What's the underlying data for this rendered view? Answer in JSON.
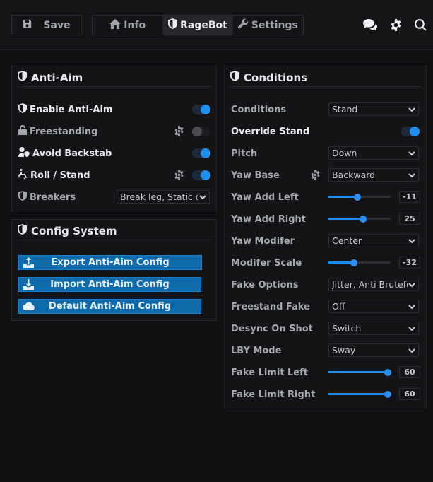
{
  "toolbar": {
    "save_label": "Save",
    "tabs": [
      {
        "label": "Info",
        "icon": "home-icon",
        "active": false
      },
      {
        "label": "RageBot",
        "icon": "shield-icon",
        "active": true
      },
      {
        "label": "Settings",
        "icon": "wrench-icon",
        "active": false
      }
    ],
    "right_icons": [
      "chat-icon",
      "gear-icon",
      "search-icon"
    ]
  },
  "anti_aim": {
    "title": "Anti-Aim",
    "rows": [
      {
        "label": "Enable Anti-Aim",
        "icon": "shield-icon",
        "toggle": true,
        "gear": false
      },
      {
        "label": "Freestanding",
        "icon": "lock-icon",
        "toggle": false,
        "gear": true
      },
      {
        "label": "Avoid Backstab",
        "icon": "user-shield-icon",
        "toggle": true,
        "gear": false
      },
      {
        "label": "Roll / Stand",
        "icon": "wheelchair-icon",
        "toggle": true,
        "gear": true
      }
    ],
    "breakers": {
      "label": "Breakers",
      "value": "Break leg, Static on"
    }
  },
  "config_system": {
    "title": "Config System",
    "buttons": [
      {
        "label": "Export Anti-Aim Config",
        "icon": "upload-icon"
      },
      {
        "label": "Import Anti-Aim Config",
        "icon": "download-icon"
      },
      {
        "label": "Default Anti-Aim Config",
        "icon": "cloud-icon"
      }
    ]
  },
  "conditions": {
    "title": "Conditions",
    "conditions_label": "Conditions",
    "conditions_value": "Stand",
    "override_label": "Override Stand",
    "override_on": true,
    "pitch_label": "Pitch",
    "pitch_value": "Down",
    "yaw_base_label": "Yaw Base",
    "yaw_base_value": "Backward",
    "yaw_add_left_label": "Yaw Add Left",
    "yaw_add_left_value": "-11",
    "yaw_add_left_fraction": 0.47,
    "yaw_add_right_label": "Yaw Add Right",
    "yaw_add_right_value": "25",
    "yaw_add_right_fraction": 0.56,
    "yaw_modifier_label": "Yaw Modifer",
    "yaw_modifier_value": "Center",
    "modifier_scale_label": "Modifer Scale",
    "modifier_scale_value": "-32",
    "modifier_scale_fraction": 0.42,
    "fake_options_label": "Fake Options",
    "fake_options_value": "Jitter, Anti Brutefo",
    "freestand_fake_label": "Freestand Fake",
    "freestand_fake_value": "Off",
    "desync_label": "Desync On Shot",
    "desync_value": "Switch",
    "lby_label": "LBY Mode",
    "lby_value": "Sway",
    "fake_limit_left_label": "Fake Limit Left",
    "fake_limit_left_value": "60",
    "fake_limit_left_fraction": 0.95,
    "fake_limit_right_label": "Fake Limit Right",
    "fake_limit_right_value": "60",
    "fake_limit_right_fraction": 0.95
  },
  "colors": {
    "accent": "#1d8ff0",
    "button": "#0e6aaa",
    "background": "#101012",
    "panel": "#141416"
  }
}
